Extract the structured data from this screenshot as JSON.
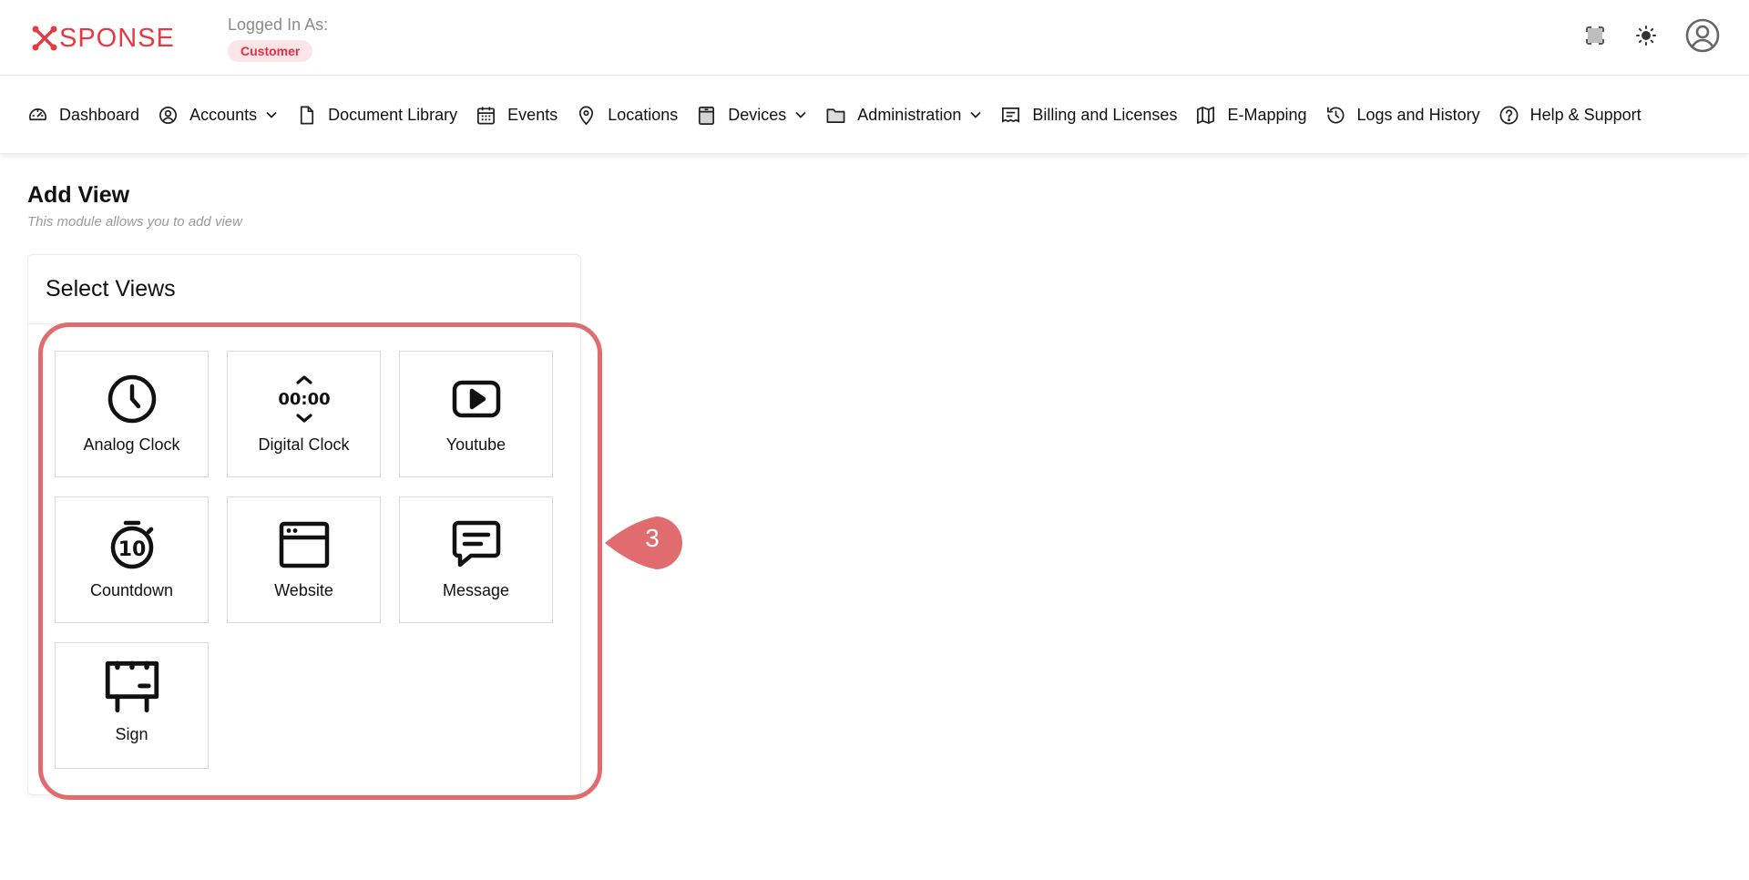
{
  "header": {
    "logo_text": "SPONSE",
    "logged_in_label": "Logged In As:",
    "role_badge": "Customer",
    "brand_color": "#e63946",
    "actions": [
      "fullscreen-icon",
      "theme-toggle-icon",
      "user-avatar-icon"
    ]
  },
  "nav": {
    "items": [
      {
        "label": "Dashboard",
        "icon": "dashboard-gauge-icon",
        "dropdown": false
      },
      {
        "label": "Accounts",
        "icon": "account-circle-icon",
        "dropdown": true
      },
      {
        "label": "Document Library",
        "icon": "document-icon",
        "dropdown": false
      },
      {
        "label": "Events",
        "icon": "calendar-icon",
        "dropdown": false
      },
      {
        "label": "Locations",
        "icon": "map-pin-icon",
        "dropdown": false
      },
      {
        "label": "Devices",
        "icon": "device-box-icon",
        "dropdown": true
      },
      {
        "label": "Administration",
        "icon": "folder-icon",
        "dropdown": true
      },
      {
        "label": "Billing and Licenses",
        "icon": "receipt-icon",
        "dropdown": false
      },
      {
        "label": "E-Mapping",
        "icon": "map-icon",
        "dropdown": false
      },
      {
        "label": "Logs and History",
        "icon": "history-icon",
        "dropdown": false
      },
      {
        "label": "Help & Support",
        "icon": "help-circle-icon",
        "dropdown": false
      }
    ]
  },
  "page": {
    "title": "Add View",
    "subtitle": "This module allows you to add view"
  },
  "card": {
    "title": "Select Views",
    "tiles": [
      {
        "label": "Analog Clock",
        "icon": "analog-clock-icon"
      },
      {
        "label": "Digital Clock",
        "icon": "digital-clock-icon"
      },
      {
        "label": "Youtube",
        "icon": "youtube-icon"
      },
      {
        "label": "Countdown",
        "icon": "countdown-timer-icon"
      },
      {
        "label": "Website",
        "icon": "browser-window-icon"
      },
      {
        "label": "Message",
        "icon": "message-bubble-icon"
      },
      {
        "label": "Sign",
        "icon": "signboard-icon"
      }
    ]
  },
  "annotation": {
    "step_number": "3",
    "color": "#e06c6f"
  }
}
